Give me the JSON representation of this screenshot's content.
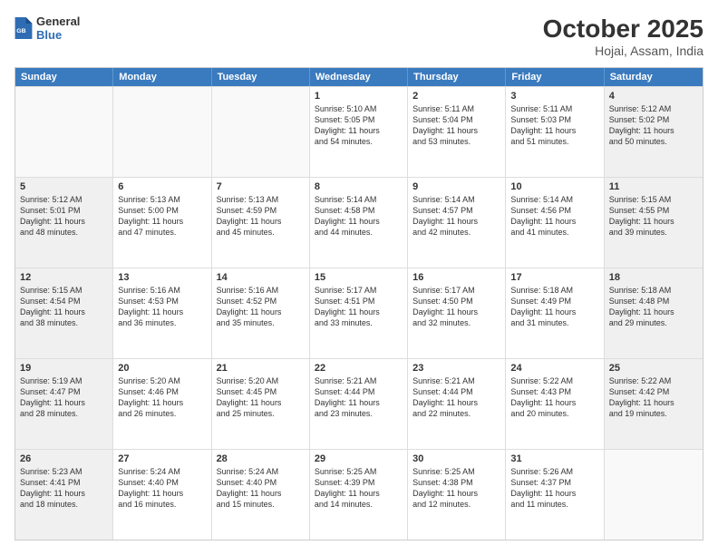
{
  "logo": {
    "general": "General",
    "blue": "Blue"
  },
  "title": "October 2025",
  "subtitle": "Hojai, Assam, India",
  "headers": [
    "Sunday",
    "Monday",
    "Tuesday",
    "Wednesday",
    "Thursday",
    "Friday",
    "Saturday"
  ],
  "weeks": [
    [
      {
        "day": "",
        "text": "",
        "empty": true
      },
      {
        "day": "",
        "text": "",
        "empty": true
      },
      {
        "day": "",
        "text": "",
        "empty": true
      },
      {
        "day": "1",
        "text": "Sunrise: 5:10 AM\nSunset: 5:05 PM\nDaylight: 11 hours\nand 54 minutes.",
        "shaded": false
      },
      {
        "day": "2",
        "text": "Sunrise: 5:11 AM\nSunset: 5:04 PM\nDaylight: 11 hours\nand 53 minutes.",
        "shaded": false
      },
      {
        "day": "3",
        "text": "Sunrise: 5:11 AM\nSunset: 5:03 PM\nDaylight: 11 hours\nand 51 minutes.",
        "shaded": false
      },
      {
        "day": "4",
        "text": "Sunrise: 5:12 AM\nSunset: 5:02 PM\nDaylight: 11 hours\nand 50 minutes.",
        "shaded": true
      }
    ],
    [
      {
        "day": "5",
        "text": "Sunrise: 5:12 AM\nSunset: 5:01 PM\nDaylight: 11 hours\nand 48 minutes.",
        "shaded": true
      },
      {
        "day": "6",
        "text": "Sunrise: 5:13 AM\nSunset: 5:00 PM\nDaylight: 11 hours\nand 47 minutes.",
        "shaded": false
      },
      {
        "day": "7",
        "text": "Sunrise: 5:13 AM\nSunset: 4:59 PM\nDaylight: 11 hours\nand 45 minutes.",
        "shaded": false
      },
      {
        "day": "8",
        "text": "Sunrise: 5:14 AM\nSunset: 4:58 PM\nDaylight: 11 hours\nand 44 minutes.",
        "shaded": false
      },
      {
        "day": "9",
        "text": "Sunrise: 5:14 AM\nSunset: 4:57 PM\nDaylight: 11 hours\nand 42 minutes.",
        "shaded": false
      },
      {
        "day": "10",
        "text": "Sunrise: 5:14 AM\nSunset: 4:56 PM\nDaylight: 11 hours\nand 41 minutes.",
        "shaded": false
      },
      {
        "day": "11",
        "text": "Sunrise: 5:15 AM\nSunset: 4:55 PM\nDaylight: 11 hours\nand 39 minutes.",
        "shaded": true
      }
    ],
    [
      {
        "day": "12",
        "text": "Sunrise: 5:15 AM\nSunset: 4:54 PM\nDaylight: 11 hours\nand 38 minutes.",
        "shaded": true
      },
      {
        "day": "13",
        "text": "Sunrise: 5:16 AM\nSunset: 4:53 PM\nDaylight: 11 hours\nand 36 minutes.",
        "shaded": false
      },
      {
        "day": "14",
        "text": "Sunrise: 5:16 AM\nSunset: 4:52 PM\nDaylight: 11 hours\nand 35 minutes.",
        "shaded": false
      },
      {
        "day": "15",
        "text": "Sunrise: 5:17 AM\nSunset: 4:51 PM\nDaylight: 11 hours\nand 33 minutes.",
        "shaded": false
      },
      {
        "day": "16",
        "text": "Sunrise: 5:17 AM\nSunset: 4:50 PM\nDaylight: 11 hours\nand 32 minutes.",
        "shaded": false
      },
      {
        "day": "17",
        "text": "Sunrise: 5:18 AM\nSunset: 4:49 PM\nDaylight: 11 hours\nand 31 minutes.",
        "shaded": false
      },
      {
        "day": "18",
        "text": "Sunrise: 5:18 AM\nSunset: 4:48 PM\nDaylight: 11 hours\nand 29 minutes.",
        "shaded": true
      }
    ],
    [
      {
        "day": "19",
        "text": "Sunrise: 5:19 AM\nSunset: 4:47 PM\nDaylight: 11 hours\nand 28 minutes.",
        "shaded": true
      },
      {
        "day": "20",
        "text": "Sunrise: 5:20 AM\nSunset: 4:46 PM\nDaylight: 11 hours\nand 26 minutes.",
        "shaded": false
      },
      {
        "day": "21",
        "text": "Sunrise: 5:20 AM\nSunset: 4:45 PM\nDaylight: 11 hours\nand 25 minutes.",
        "shaded": false
      },
      {
        "day": "22",
        "text": "Sunrise: 5:21 AM\nSunset: 4:44 PM\nDaylight: 11 hours\nand 23 minutes.",
        "shaded": false
      },
      {
        "day": "23",
        "text": "Sunrise: 5:21 AM\nSunset: 4:44 PM\nDaylight: 11 hours\nand 22 minutes.",
        "shaded": false
      },
      {
        "day": "24",
        "text": "Sunrise: 5:22 AM\nSunset: 4:43 PM\nDaylight: 11 hours\nand 20 minutes.",
        "shaded": false
      },
      {
        "day": "25",
        "text": "Sunrise: 5:22 AM\nSunset: 4:42 PM\nDaylight: 11 hours\nand 19 minutes.",
        "shaded": true
      }
    ],
    [
      {
        "day": "26",
        "text": "Sunrise: 5:23 AM\nSunset: 4:41 PM\nDaylight: 11 hours\nand 18 minutes.",
        "shaded": true
      },
      {
        "day": "27",
        "text": "Sunrise: 5:24 AM\nSunset: 4:40 PM\nDaylight: 11 hours\nand 16 minutes.",
        "shaded": false
      },
      {
        "day": "28",
        "text": "Sunrise: 5:24 AM\nSunset: 4:40 PM\nDaylight: 11 hours\nand 15 minutes.",
        "shaded": false
      },
      {
        "day": "29",
        "text": "Sunrise: 5:25 AM\nSunset: 4:39 PM\nDaylight: 11 hours\nand 14 minutes.",
        "shaded": false
      },
      {
        "day": "30",
        "text": "Sunrise: 5:25 AM\nSunset: 4:38 PM\nDaylight: 11 hours\nand 12 minutes.",
        "shaded": false
      },
      {
        "day": "31",
        "text": "Sunrise: 5:26 AM\nSunset: 4:37 PM\nDaylight: 11 hours\nand 11 minutes.",
        "shaded": false
      },
      {
        "day": "",
        "text": "",
        "empty": true
      }
    ]
  ]
}
